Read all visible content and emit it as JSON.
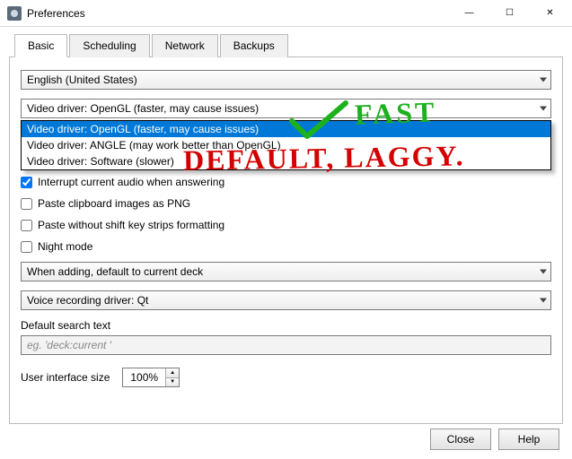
{
  "window": {
    "title": "Preferences",
    "buttons": {
      "min": "—",
      "max": "☐",
      "close": "✕"
    }
  },
  "tabs": [
    "Basic",
    "Scheduling",
    "Network",
    "Backups"
  ],
  "active_tab": "Basic",
  "language_selected": "English (United States)",
  "video_driver": {
    "selected": "Video driver: OpenGL (faster, may cause issues)",
    "options": [
      "Video driver: OpenGL (faster, may cause issues)",
      "Video driver: ANGLE (may work better than OpenGL)",
      "Video driver: Software (slower)"
    ]
  },
  "checkboxes": {
    "interrupt_audio": {
      "label": "Interrupt current audio when answering",
      "checked": true
    },
    "paste_png": {
      "label": "Paste clipboard images as PNG",
      "checked": false
    },
    "paste_strip": {
      "label": "Paste without shift key strips formatting",
      "checked": false
    },
    "night_mode": {
      "label": "Night mode",
      "checked": false
    }
  },
  "deck_default_selected": "When adding, default to current deck",
  "voice_driver_selected": "Voice recording driver: Qt",
  "search": {
    "label": "Default search text",
    "placeholder": "eg. 'deck:current '"
  },
  "ui_size": {
    "label": "User interface size",
    "value": "100%"
  },
  "footer": {
    "close": "Close",
    "help": "Help"
  },
  "annotations": {
    "fast": "FAST",
    "laggy": "DEFAULT, LAGGY."
  }
}
